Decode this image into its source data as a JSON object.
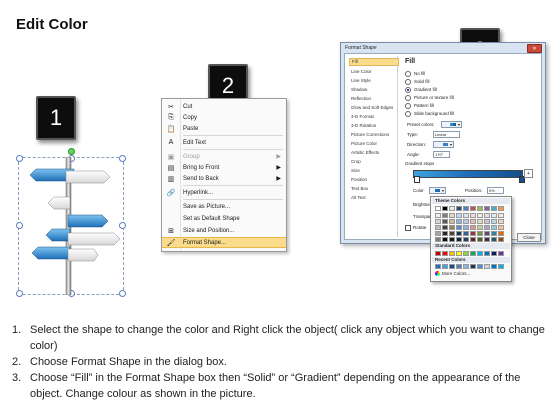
{
  "title": "Edit Color",
  "steps": {
    "one": "1",
    "two": "2",
    "three": "3"
  },
  "context_menu": {
    "items": [
      {
        "label": "Cut",
        "icon": "scissors-icon",
        "glyph": "✂",
        "enabled": true
      },
      {
        "label": "Copy",
        "icon": "copy-icon",
        "glyph": "⎘",
        "enabled": true
      },
      {
        "label": "Paste",
        "icon": "paste-icon",
        "glyph": "📋",
        "enabled": true
      },
      {
        "label": "Edit Text",
        "icon": "edit-text-icon",
        "glyph": "A",
        "enabled": true
      },
      {
        "label": "Group",
        "icon": "group-icon",
        "glyph": "▣",
        "enabled": false,
        "submenu": true
      },
      {
        "label": "Bring to Front",
        "icon": "bring-front-icon",
        "glyph": "▤",
        "enabled": true,
        "submenu": true
      },
      {
        "label": "Send to Back",
        "icon": "send-back-icon",
        "glyph": "▥",
        "enabled": true,
        "submenu": true
      },
      {
        "label": "Hyperlink...",
        "icon": "hyperlink-icon",
        "glyph": "🔗",
        "enabled": true
      },
      {
        "label": "Save as Picture...",
        "icon": "",
        "glyph": "",
        "enabled": true
      },
      {
        "label": "Set as Default Shape",
        "icon": "",
        "glyph": "",
        "enabled": true
      },
      {
        "label": "Size and Position...",
        "icon": "size-icon",
        "glyph": "⊞",
        "enabled": true
      },
      {
        "label": "Format Shape...",
        "icon": "format-shape-icon",
        "glyph": "🖌",
        "enabled": true,
        "highlighted": true
      }
    ]
  },
  "dialog": {
    "title": "Format Shape",
    "close_label": "✕",
    "nav": [
      "Fill",
      "Line Color",
      "Line Style",
      "Shadow",
      "Reflection",
      "Glow and Soft Edges",
      "3-D Format",
      "3-D Rotation",
      "Picture Corrections",
      "Picture Color",
      "Artistic Effects",
      "Crop",
      "Size",
      "Position",
      "Text Box",
      "Alt Text"
    ],
    "fill_heading": "Fill",
    "fill_options": [
      {
        "label": "No fill",
        "checked": false
      },
      {
        "label": "Solid fill",
        "checked": false
      },
      {
        "label": "Gradient fill",
        "checked": true
      },
      {
        "label": "Picture or texture fill",
        "checked": false
      },
      {
        "label": "Pattern fill",
        "checked": false
      },
      {
        "label": "Slide background fill",
        "checked": false
      }
    ],
    "preset_colors_label": "Preset colors:",
    "type_label": "Type:",
    "type_value": "Linear",
    "direction_label": "Direction:",
    "angle_label": "Angle:",
    "angle_value": "170°",
    "gradient_stops_label": "Gradient stops",
    "color_label": "Color",
    "position_label": "Position:",
    "position_value": "0%",
    "brightness_label": "Brightness",
    "transparency_label": "Transparen",
    "rotate_label": "Rotate",
    "close_button": "Close"
  },
  "palette": {
    "theme_heading": "Theme Colors",
    "standard_heading": "Standard Colors",
    "recent_heading": "Recent Colors",
    "more_label": "More Colors...",
    "theme_top": [
      "#ffffff",
      "#000000",
      "#eeece1",
      "#1f497d",
      "#4f81bd",
      "#c0504d",
      "#9bbb59",
      "#8064a2",
      "#4bacc6",
      "#f79646"
    ],
    "theme_tints": [
      [
        "#f2f2f2",
        "#7f7f7f",
        "#ddd9c3",
        "#c6d9f0",
        "#dbe5f1",
        "#f2dcdb",
        "#ebf1dd",
        "#e5e0ec",
        "#dbeef3",
        "#fdeada"
      ],
      [
        "#d8d8d8",
        "#595959",
        "#c4bd97",
        "#8db3e2",
        "#b8cce4",
        "#e5b9b7",
        "#d7e3bc",
        "#ccc1d9",
        "#b7dde8",
        "#fbd5b5"
      ],
      [
        "#bfbfbf",
        "#3f3f3f",
        "#938953",
        "#548dd4",
        "#95b3d7",
        "#d99694",
        "#c3d69b",
        "#b2a2c7",
        "#92cddc",
        "#fac08f"
      ],
      [
        "#a5a5a5",
        "#262626",
        "#494429",
        "#17365d",
        "#366092",
        "#953734",
        "#76923c",
        "#5f497a",
        "#31859b",
        "#e36c09"
      ],
      [
        "#7f7f7f",
        "#0c0c0c",
        "#1d1b10",
        "#0f243e",
        "#244061",
        "#632423",
        "#4f6128",
        "#3f3151",
        "#205867",
        "#974806"
      ]
    ],
    "standard": [
      "#c00000",
      "#ff0000",
      "#ffc000",
      "#ffff00",
      "#92d050",
      "#00b050",
      "#00b0f0",
      "#0070c0",
      "#002060",
      "#7030a0"
    ],
    "recent": [
      "#1f6fb8",
      "#3fa2e0",
      "#144e8c",
      "#4f81bd",
      "#8db3e2",
      "#17365d",
      "#548dd4",
      "#c6d9f0",
      "#0070c0",
      "#00b0f0"
    ]
  },
  "instructions": [
    {
      "num": "1.",
      "text": "Select the shape to change the color and Right click the object( click any object which you want to change color)"
    },
    {
      "num": "2.",
      "text": "Choose Format Shape in the dialog box."
    },
    {
      "num": "3.",
      "text": "Choose “Fill” in the Format Shape box then “Solid” or “Gradient” depending on the appearance of the object. Change colour as shown in the picture."
    }
  ]
}
